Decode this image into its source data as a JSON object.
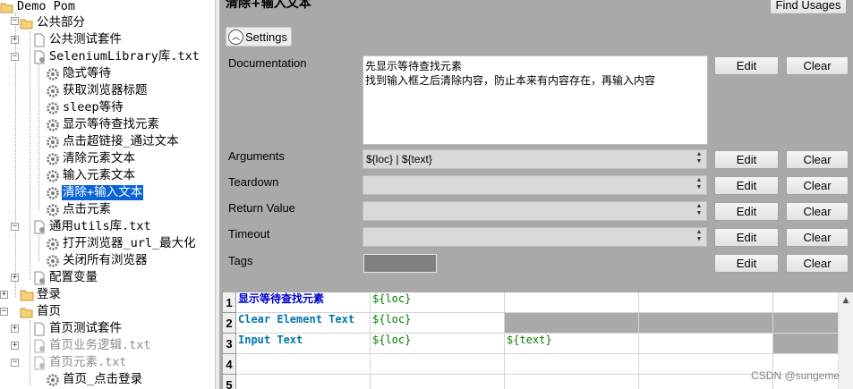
{
  "tree": {
    "nodes": [
      {
        "label": "Demo Pom",
        "icon": "folder-open-icon"
      },
      {
        "label": "公共部分",
        "icon": "folder-open-icon"
      },
      {
        "label": "公共测试套件",
        "icon": "file-icon"
      },
      {
        "label": "SeleniumLibrary库.txt",
        "icon": "resource-file-icon"
      },
      {
        "label": "隐式等待",
        "icon": "gear-icon"
      },
      {
        "label": "获取浏览器标题",
        "icon": "gear-icon"
      },
      {
        "label": "sleep等待",
        "icon": "gear-icon"
      },
      {
        "label": "显示等待查找元素",
        "icon": "gear-icon"
      },
      {
        "label": "点击超链接_通过文本",
        "icon": "gear-icon"
      },
      {
        "label": "清除元素文本",
        "icon": "gear-icon"
      },
      {
        "label": "输入元素文本",
        "icon": "gear-icon"
      },
      {
        "label": "清除+输入文本",
        "icon": "gear-icon"
      },
      {
        "label": "点击元素",
        "icon": "gear-icon"
      },
      {
        "label": "通用utils库.txt",
        "icon": "resource-file-icon"
      },
      {
        "label": "打开浏览器_url_最大化",
        "icon": "gear-icon"
      },
      {
        "label": "关闭所有浏览器",
        "icon": "gear-icon"
      },
      {
        "label": "配置变量",
        "icon": "resource-file-icon"
      },
      {
        "label": "登录",
        "icon": "folder-closed-icon"
      },
      {
        "label": "首页",
        "icon": "folder-open-icon"
      },
      {
        "label": "首页测试套件",
        "icon": "file-icon"
      },
      {
        "label": "首页业务逻辑.txt",
        "icon": "resource-file-icon"
      },
      {
        "label": "首页元素.txt",
        "icon": "resource-file-icon"
      },
      {
        "label": "首页_点击登录",
        "icon": "gear-icon"
      }
    ]
  },
  "editor": {
    "title": "清除+输入文本",
    "find_usages": "Find Usages",
    "settings_label": "Settings",
    "edit_label": "Edit",
    "clear_label": "Clear",
    "documentation": {
      "label": "Documentation",
      "line1": "先显示等待查找元素",
      "line2": "找到输入框之后清除内容，防止本来有内容存在，再输入内容"
    },
    "fields": {
      "arguments": {
        "label": "Arguments",
        "value": "${loc} | ${text}"
      },
      "teardown": {
        "label": "Teardown",
        "value": ""
      },
      "return_value": {
        "label": "Return Value",
        "value": ""
      },
      "timeout": {
        "label": "Timeout",
        "value": ""
      },
      "tags": {
        "label": "Tags"
      }
    }
  },
  "grid": {
    "rows": [
      {
        "num": "1",
        "c1": "显示等待查找元素",
        "c2": "${loc}",
        "c3": ""
      },
      {
        "num": "2",
        "c1": "Clear Element Text",
        "c2": "${loc}",
        "c3": ""
      },
      {
        "num": "3",
        "c1": "Input Text",
        "c2": "${loc}",
        "c3": "${text}"
      },
      {
        "num": "4",
        "c1": "",
        "c2": "",
        "c3": ""
      },
      {
        "num": "5",
        "c1": "",
        "c2": "",
        "c3": ""
      }
    ]
  },
  "watermark": "CSDN @sungeme"
}
